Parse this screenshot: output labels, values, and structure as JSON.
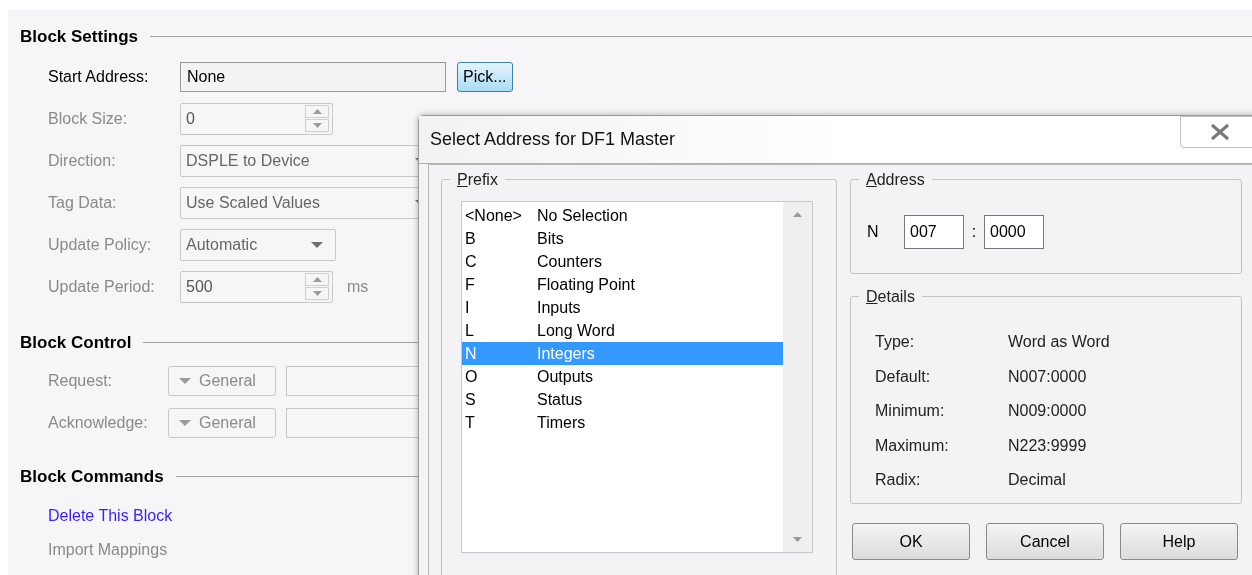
{
  "block_settings": {
    "title": "Block Settings",
    "fields": [
      {
        "label": "Start Address:",
        "kind": "text",
        "value": "None",
        "button": "Pick...",
        "disabled": false
      },
      {
        "label": "Block Size:",
        "kind": "spin",
        "value": "0",
        "disabled": true
      },
      {
        "label": "Direction:",
        "kind": "dropdown",
        "value": "DSPLE to Device",
        "wide": true,
        "disabled": true
      },
      {
        "label": "Tag Data:",
        "kind": "dropdown",
        "value": "Use Scaled Values",
        "wide": true,
        "disabled": true
      },
      {
        "label": "Update Policy:",
        "kind": "dropdown",
        "value": "Automatic",
        "wide": false,
        "disabled": true
      },
      {
        "label": "Update Period:",
        "kind": "spin",
        "value": "500",
        "unit": "ms",
        "disabled": true
      }
    ]
  },
  "block_control": {
    "title": "Block Control",
    "rows": [
      {
        "label": "Request:",
        "menu": "General",
        "disabled": true
      },
      {
        "label": "Acknowledge:",
        "menu": "General",
        "disabled": true
      }
    ]
  },
  "block_commands": {
    "title": "Block Commands",
    "links": [
      {
        "label": "Delete This Block",
        "disabled": false
      },
      {
        "label": "Import Mappings",
        "disabled": true
      }
    ]
  },
  "dialog": {
    "title": "Select Address for DF1 Master",
    "prefix": {
      "title": "Prefix",
      "items": [
        {
          "prefix": "<None>",
          "name": "No Selection",
          "selected": false
        },
        {
          "prefix": "B",
          "name": "Bits",
          "selected": false
        },
        {
          "prefix": "C",
          "name": "Counters",
          "selected": false
        },
        {
          "prefix": "F",
          "name": "Floating Point",
          "selected": false
        },
        {
          "prefix": "I",
          "name": "Inputs",
          "selected": false
        },
        {
          "prefix": "L",
          "name": "Long Word",
          "selected": false
        },
        {
          "prefix": "N",
          "name": "Integers",
          "selected": true
        },
        {
          "prefix": "O",
          "name": "Outputs",
          "selected": false
        },
        {
          "prefix": "S",
          "name": "Status",
          "selected": false
        },
        {
          "prefix": "T",
          "name": "Timers",
          "selected": false
        }
      ]
    },
    "address": {
      "title": "Address",
      "prefix": "N",
      "file": "007",
      "separator": ":",
      "element": "0000"
    },
    "details": {
      "title": "Details",
      "rows": [
        {
          "label": "Type:",
          "value": "Word as Word"
        },
        {
          "label": "Default:",
          "value": "N007:0000"
        },
        {
          "label": "Minimum:",
          "value": "N009:0000"
        },
        {
          "label": "Maximum:",
          "value": "N223:9999"
        },
        {
          "label": "Radix:",
          "value": "Decimal"
        }
      ]
    },
    "buttons": [
      "OK",
      "Cancel",
      "Help"
    ]
  }
}
